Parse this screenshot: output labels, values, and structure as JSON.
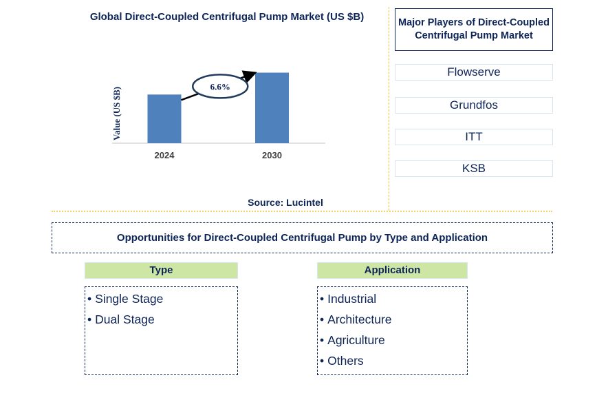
{
  "chart_data": {
    "type": "bar",
    "title": "Global Direct-Coupled Centrifugal Pump Market (US $B)",
    "xlabel": "",
    "ylabel": "Value (US $B)",
    "categories": [
      "2024",
      "2030"
    ],
    "values": [
      1.0,
      1.45
    ],
    "value_note": "No axis ticks shown; values are relative bar heights",
    "ylim": [
      0,
      1.5
    ],
    "grid": false,
    "annotation": {
      "label": "6.6%",
      "meaning": "CAGR 2024-2030",
      "from": "2024",
      "to": "2030"
    },
    "bar_color": "#4f81bd",
    "source": "Source: Lucintel"
  },
  "players": {
    "title": "Major Players of Direct-Coupled Centrifugal Pump Market",
    "items": [
      "Flowserve",
      "Grundfos",
      "ITT",
      "KSB"
    ]
  },
  "opportunities": {
    "title": "Opportunities for Direct-Coupled Centrifugal Pump by Type and Application",
    "type": {
      "header": "Type",
      "items": [
        "Single Stage",
        "Dual Stage"
      ]
    },
    "application": {
      "header": "Application",
      "items": [
        "Industrial",
        "Architecture",
        "Agriculture",
        "Others"
      ]
    }
  },
  "colors": {
    "text": "#0d2457",
    "header_fill": "#cde6a3",
    "separator": "#f2c02e"
  }
}
